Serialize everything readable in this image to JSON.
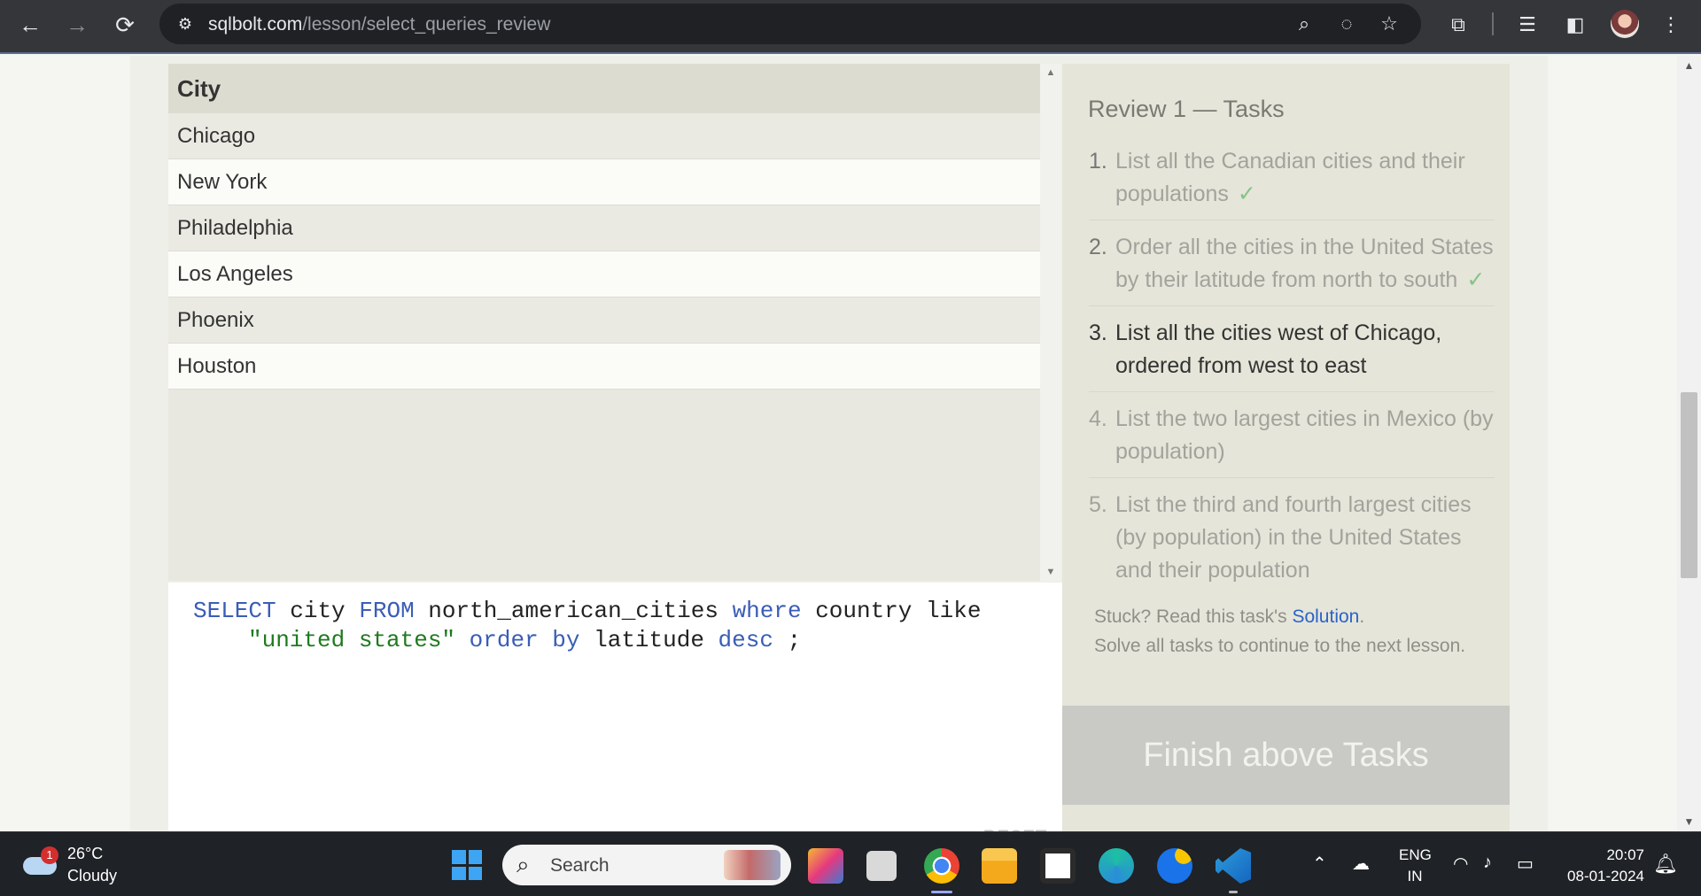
{
  "browser": {
    "url_host": "sqlbolt.com",
    "url_path": "/lesson/select_queries_review",
    "icons": [
      "back-icon",
      "forward-icon",
      "reload-icon",
      "site-settings-icon",
      "zoom-icon",
      "eye-off-icon",
      "star-icon",
      "extensions-icon",
      "media-icon",
      "side-panel-icon",
      "profile-avatar",
      "menu-icon"
    ]
  },
  "results": {
    "column": "City",
    "rows": [
      "Chicago",
      "New York",
      "Philadelphia",
      "Los Angeles",
      "Phoenix",
      "Houston"
    ]
  },
  "editor": {
    "tokens": {
      "select": "SELECT",
      "city": "city",
      "from": "FROM",
      "table": "north_american_cities",
      "where": "where",
      "country": "country",
      "like": "like",
      "value": "\"united states\"",
      "order": "order",
      "by": "by",
      "latitude": "latitude",
      "desc": "desc",
      "semicolon": ";"
    },
    "reset_label": "RESET"
  },
  "tasks": {
    "title": "Review 1 — Tasks",
    "items": [
      {
        "num": "1.",
        "text": "List all the Canadian cities and their populations",
        "status": "done"
      },
      {
        "num": "2.",
        "text": "Order all the cities in the United States by their latitude from north to south",
        "status": "done"
      },
      {
        "num": "3.",
        "text": "List all the cities west of Chicago, ordered from west to east",
        "status": "active"
      },
      {
        "num": "4.",
        "text": "List the two largest cities in Mexico (by population)",
        "status": "pending"
      },
      {
        "num": "5.",
        "text": "List the third and fourth largest cities (by population) in the United States and their population",
        "status": "pending"
      }
    ],
    "check_mark": "✓",
    "stuck_prefix": "Stuck? Read this task's ",
    "solution_link": "Solution",
    "stuck_suffix": ".",
    "continue_text": "Solve all tasks to continue to the next lesson.",
    "finish_button": "Finish above Tasks"
  },
  "taskbar": {
    "weather": {
      "badge": "1",
      "temp": "26°C",
      "desc": "Cloudy"
    },
    "search_placeholder": "Search",
    "lang_line1": "ENG",
    "lang_line2": "IN",
    "time": "20:07",
    "date": "08-01-2024"
  },
  "colors": {
    "keyword": "#3a5db6",
    "string": "#1f7a1f",
    "link": "#2a63c9",
    "check": "#86c486",
    "toolbar": "#35363a"
  }
}
